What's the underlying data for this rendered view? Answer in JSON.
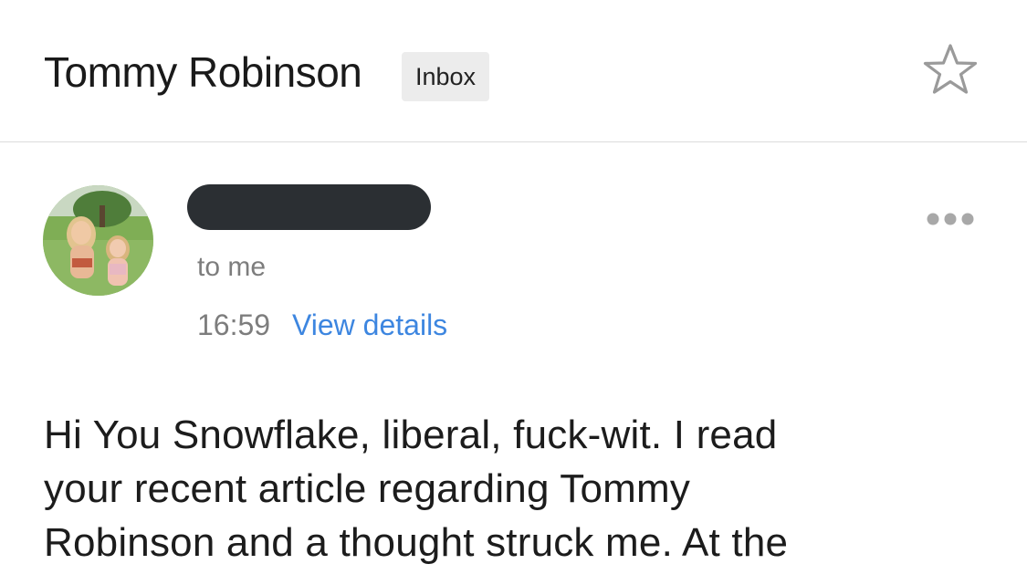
{
  "header": {
    "subject": "Tommy Robinson",
    "label": "Inbox",
    "star_icon": "star-outline-icon"
  },
  "message": {
    "sender_redacted": true,
    "recipient": "to me",
    "time": "16:59",
    "view_details": "View details",
    "more_icon": "more-horizontal-icon",
    "body_lines": [
      "Hi You Snowflake, liberal, fuck-wit. I read",
      "your recent article regarding Tommy",
      "Robinson and a thought struck me. At the"
    ]
  },
  "colors": {
    "link": "#3d86e0",
    "muted": "#7d7d7d",
    "badge_bg": "#ececec",
    "redaction": "#2b2f33"
  }
}
